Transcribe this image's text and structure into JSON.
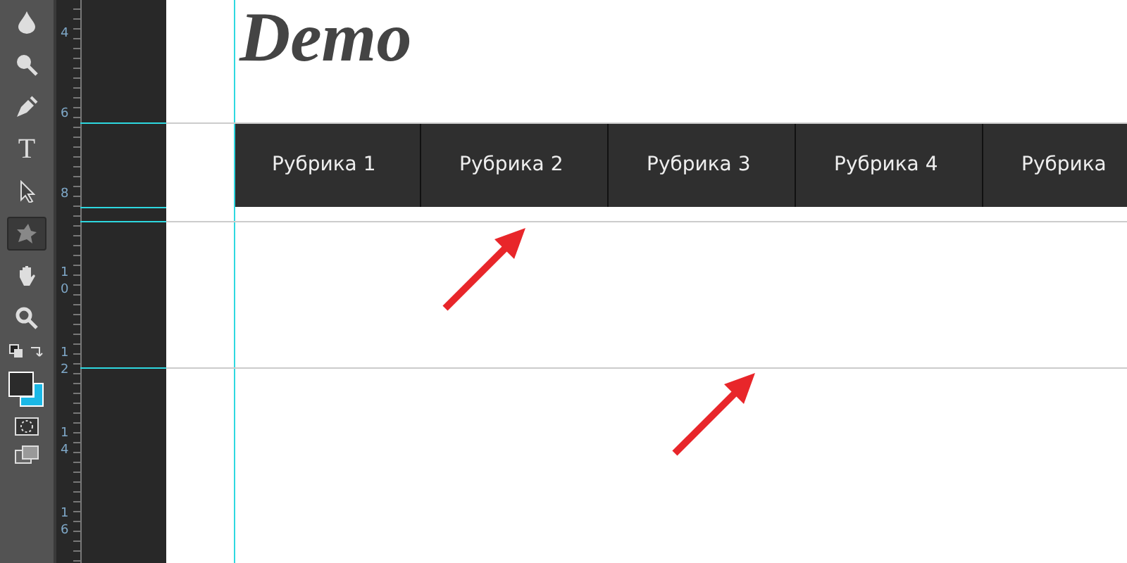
{
  "tools": [
    {
      "kind": "drop",
      "selected": false
    },
    {
      "kind": "magnifier",
      "selected": false
    },
    {
      "kind": "pen",
      "selected": false
    },
    {
      "kind": "type",
      "label": "T",
      "selected": false
    },
    {
      "kind": "arrow",
      "selected": false
    },
    {
      "kind": "shape",
      "selected": true
    },
    {
      "kind": "hand",
      "selected": false
    },
    {
      "kind": "zoom",
      "selected": false
    }
  ],
  "swatches": [
    {
      "kind": "background",
      "color": "#1ab8e6"
    },
    {
      "kind": "foreground",
      "color": "#2b2b2b"
    }
  ],
  "ruler": [
    "4",
    "6",
    "8",
    "10",
    "12",
    "14",
    "16"
  ],
  "logo": "Demo",
  "menu": [
    {
      "label": "Рубрика 1"
    },
    {
      "label": "Рубрика 2"
    },
    {
      "label": "Рубрика 3"
    },
    {
      "label": "Рубрика 4"
    },
    {
      "label": "Рубрика"
    }
  ]
}
